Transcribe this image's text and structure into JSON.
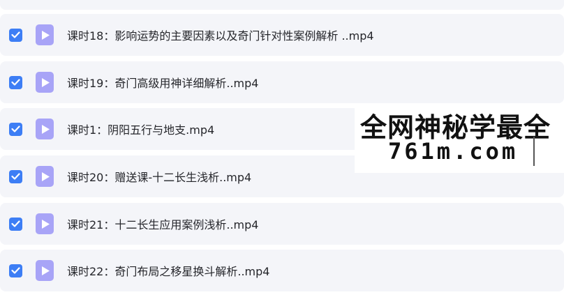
{
  "files": [
    {
      "name": "",
      "checked": true
    },
    {
      "name": "课时18：影响运势的主要因素以及奇门针对性案例解析 ..mp4",
      "checked": true
    },
    {
      "name": "课时19：奇门高级用神详细解析..mp4",
      "checked": true
    },
    {
      "name": "课时1：阴阳五行与地支.mp4",
      "checked": true
    },
    {
      "name": "课时20：赠送课-十二长生浅析..mp4",
      "checked": true
    },
    {
      "name": "课时21：十二长生应用案例浅析..mp4",
      "checked": true
    },
    {
      "name": "课时22：奇门布局之移星换斗解析..mp4",
      "checked": true
    }
  ],
  "watermark": {
    "line1": "全网神秘学最全",
    "line2": "761m.com"
  },
  "colors": {
    "row_background": "#f4f5f9",
    "checkbox": "#3d7ef5",
    "file_icon": "#a8a4f7"
  },
  "icons": {
    "checkbox": "checkmark-icon",
    "file": "video-file-icon"
  }
}
